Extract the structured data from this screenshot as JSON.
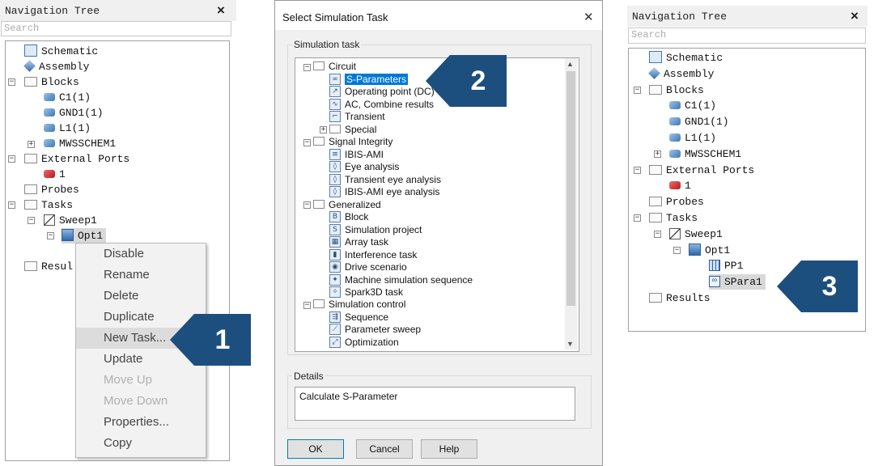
{
  "panel1": {
    "title": "Navigation Tree",
    "close": "×",
    "search_placeholder": "Search",
    "tree": {
      "schematic": "Schematic",
      "assembly": "Assembly",
      "blocks": "Blocks",
      "c1": "C1(1)",
      "gnd1": "GND1(1)",
      "l1": "L1(1)",
      "mwsschem1": "MWSSCHEM1",
      "external_ports": "External Ports",
      "port1": "1",
      "probes": "Probes",
      "tasks": "Tasks",
      "sweep1": "Sweep1",
      "opt1": "Opt1",
      "results_partial": "Resul"
    },
    "context_menu": [
      "Disable",
      "Rename",
      "Delete",
      "Duplicate",
      "New Task...",
      "Update",
      "Move Up",
      "Move Down",
      "Properties...",
      "Copy"
    ]
  },
  "dialog": {
    "title": "Select Simulation Task",
    "close": "✕",
    "group_label": "Simulation task",
    "circuit": "Circuit",
    "s_parameters": "S-Parameters",
    "operating_point": "Operating point (DC)",
    "ac_combine": "AC, Combine results",
    "transient": "Transient",
    "special": "Special",
    "signal_integrity": "Signal Integrity",
    "ibis_ami": "IBIS-AMI",
    "eye_analysis": "Eye analysis",
    "transient_eye": "Transient eye analysis",
    "ibis_ami_eye": "IBIS-AMI eye analysis",
    "generalized": "Generalized",
    "block": "Block",
    "simulation_project": "Simulation project",
    "array_task": "Array task",
    "interference_task": "Interference task",
    "drive_scenario": "Drive scenario",
    "machine_sim_seq": "Machine simulation sequence",
    "spark3d": "Spark3D task",
    "simulation_control": "Simulation control",
    "sequence": "Sequence",
    "parameter_sweep": "Parameter sweep",
    "optimization": "Optimization",
    "details_label": "Details",
    "details_text": "Calculate S-Parameter",
    "ok": "OK",
    "cancel": "Cancel",
    "help": "Help"
  },
  "panel3": {
    "title": "Navigation Tree",
    "close": "×",
    "search_placeholder": "Search",
    "tree": {
      "schematic": "Schematic",
      "assembly": "Assembly",
      "blocks": "Blocks",
      "c1": "C1(1)",
      "gnd1": "GND1(1)",
      "l1": "L1(1)",
      "mwsschem1": "MWSSCHEM1",
      "external_ports": "External Ports",
      "port1": "1",
      "probes": "Probes",
      "tasks": "Tasks",
      "sweep1": "Sweep1",
      "opt1": "Opt1",
      "pp1": "PP1",
      "spara1": "SPara1",
      "results": "Results"
    }
  },
  "callouts": {
    "one": "1",
    "two": "2",
    "three": "3"
  },
  "colors": {
    "callout": "#1d4f7e",
    "selection": "#0078d7"
  }
}
